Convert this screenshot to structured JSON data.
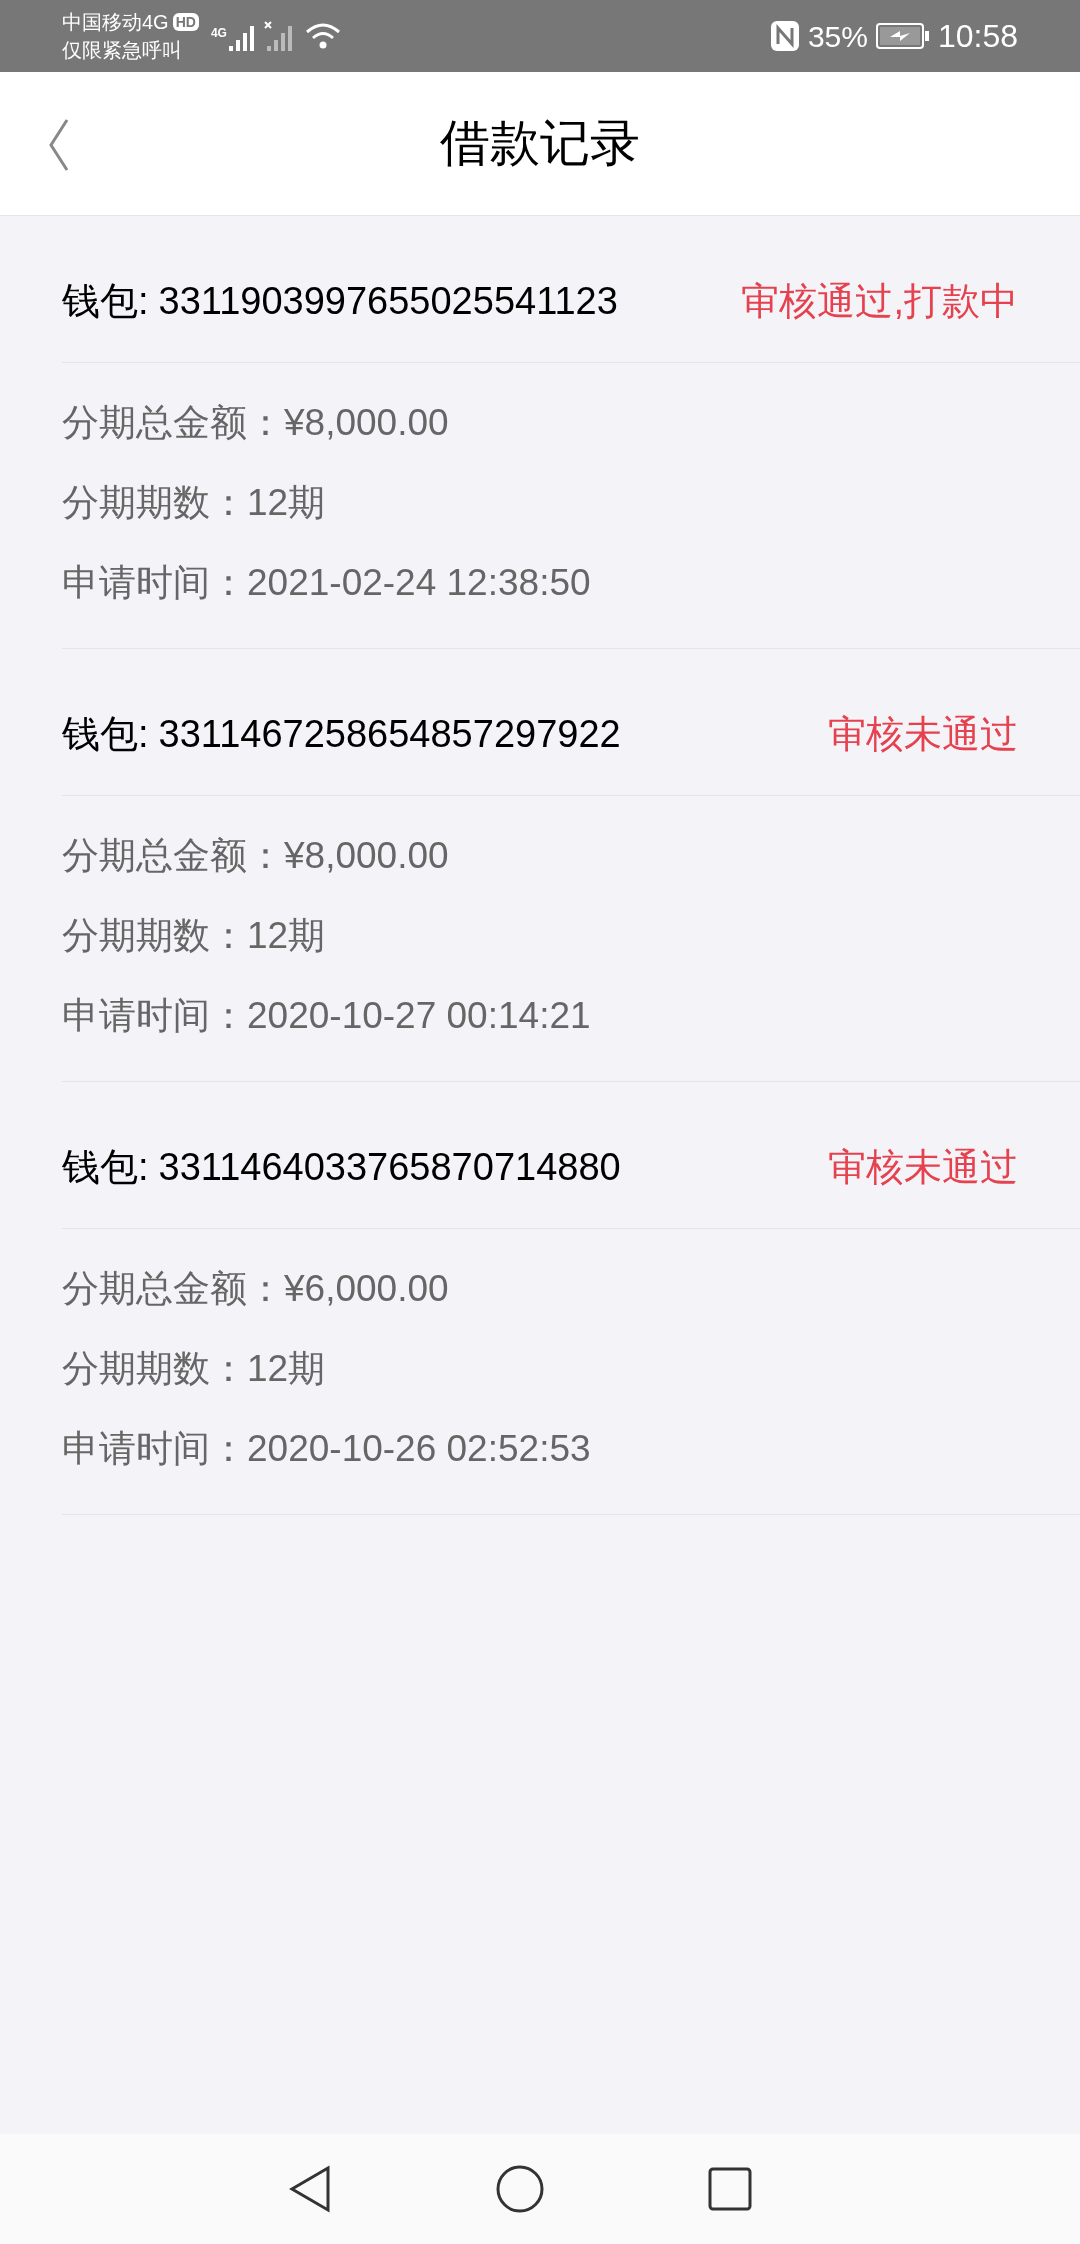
{
  "status_bar": {
    "carrier": "中国移动4G",
    "hd_badge": "HD",
    "carrier_note": "仅限紧急呼叫",
    "signal_label": "4G",
    "battery": "35%",
    "time": "10:58"
  },
  "header": {
    "title": "借款记录"
  },
  "records": [
    {
      "wallet_label": "钱包:",
      "wallet_id": "3311903997655025541123",
      "status": "审核通过,打款中",
      "fields": [
        {
          "label": "分期总金额：",
          "value": "¥8,000.00"
        },
        {
          "label": "分期期数：",
          "value": "12期"
        },
        {
          "label": "申请时间：",
          "value": "2021-02-24 12:38:50"
        }
      ]
    },
    {
      "wallet_label": "钱包:",
      "wallet_id": "3311467258654857297922",
      "status": "审核未通过",
      "fields": [
        {
          "label": "分期总金额：",
          "value": "¥8,000.00"
        },
        {
          "label": "分期期数：",
          "value": "12期"
        },
        {
          "label": "申请时间：",
          "value": "2020-10-27 00:14:21"
        }
      ]
    },
    {
      "wallet_label": "钱包:",
      "wallet_id": "3311464033765870714880",
      "status": "审核未通过",
      "fields": [
        {
          "label": "分期总金额：",
          "value": "¥6,000.00"
        },
        {
          "label": "分期期数：",
          "value": "12期"
        },
        {
          "label": "申请时间：",
          "value": "2020-10-26 02:52:53"
        }
      ]
    }
  ]
}
